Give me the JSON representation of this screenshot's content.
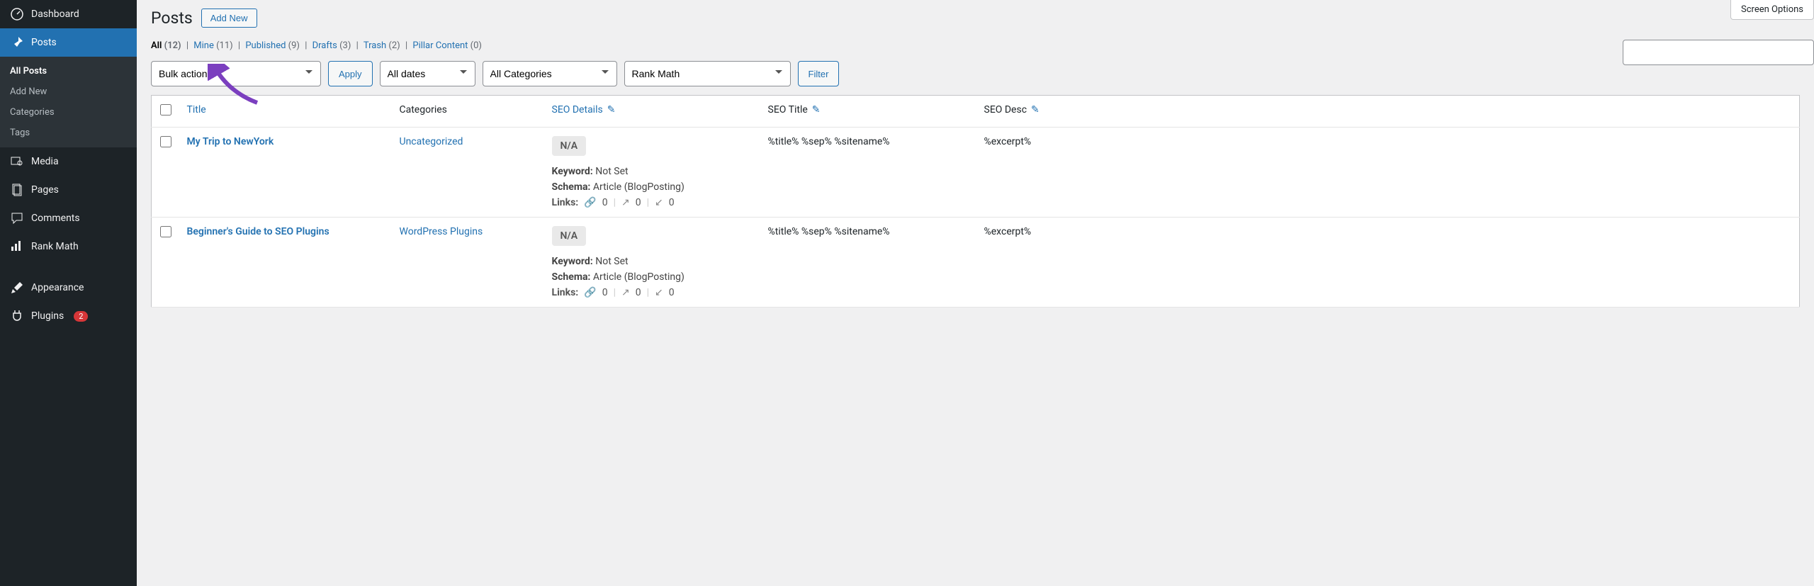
{
  "sidebar": {
    "dashboard": "Dashboard",
    "posts": "Posts",
    "media": "Media",
    "pages": "Pages",
    "comments": "Comments",
    "rank_math": "Rank Math",
    "appearance": "Appearance",
    "plugins": "Plugins",
    "plugins_badge": "2",
    "submenu": {
      "all_posts": "All Posts",
      "add_new": "Add New",
      "categories": "Categories",
      "tags": "Tags"
    }
  },
  "header": {
    "title": "Posts",
    "add_new": "Add New",
    "screen_options": "Screen Options"
  },
  "filters": {
    "all_label": "All",
    "all_count": "(12)",
    "mine_label": "Mine",
    "mine_count": "(11)",
    "published_label": "Published",
    "published_count": "(9)",
    "drafts_label": "Drafts",
    "drafts_count": "(3)",
    "trash_label": "Trash",
    "trash_count": "(2)",
    "pillar_label": "Pillar Content",
    "pillar_count": "(0)"
  },
  "controls": {
    "bulk_actions": "Bulk actions",
    "apply": "Apply",
    "all_dates": "All dates",
    "all_categories": "All Categories",
    "rank_math": "Rank Math",
    "filter": "Filter"
  },
  "columns": {
    "title": "Title",
    "categories": "Categories",
    "seo_details": "SEO Details",
    "seo_title": "SEO Title",
    "seo_desc": "SEO Desc"
  },
  "rows": [
    {
      "title": "My Trip to NewYork",
      "category": "Uncategorized",
      "seo_badge": "N/A",
      "keyword_label": "Keyword:",
      "keyword_value": "Not Set",
      "schema_label": "Schema:",
      "schema_value": "Article (BlogPosting)",
      "links_label": "Links:",
      "links_internal": "0",
      "links_external": "0",
      "links_incoming": "0",
      "seo_title": "%title% %sep% %sitename%",
      "seo_desc": "%excerpt%"
    },
    {
      "title": "Beginner's Guide to SEO Plugins",
      "category": "WordPress Plugins",
      "seo_badge": "N/A",
      "keyword_label": "Keyword:",
      "keyword_value": "Not Set",
      "schema_label": "Schema:",
      "schema_value": "Article (BlogPosting)",
      "links_label": "Links:",
      "links_internal": "0",
      "links_external": "0",
      "links_incoming": "0",
      "seo_title": "%title% %sep% %sitename%",
      "seo_desc": "%excerpt%"
    }
  ]
}
